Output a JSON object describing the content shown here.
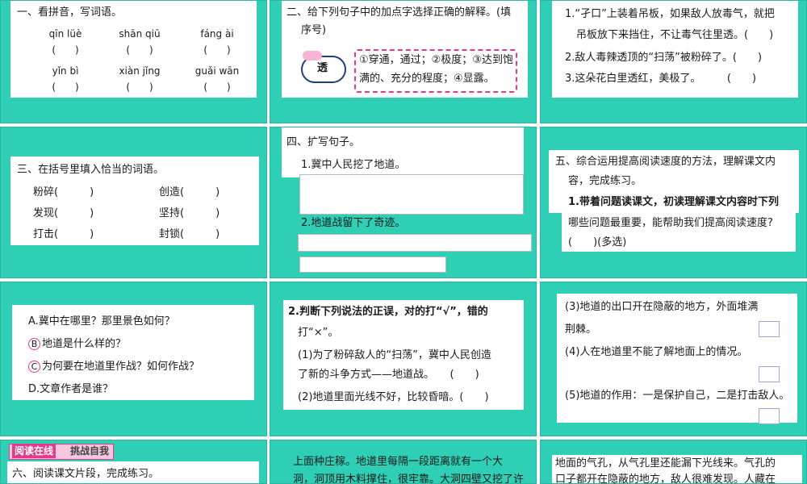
{
  "s1": {
    "title": "一、看拼音，写词语。",
    "row1": [
      "qīn lüè",
      "shān qiū",
      "fáng ài"
    ],
    "row2": [
      "yǐn bì",
      "xiàn jǐng",
      "guǎi wān"
    ],
    "paren": "(　　)"
  },
  "s2": {
    "title": "二、给下列句子中的加点字选择正确的解释。(填",
    "title2": "序号)",
    "word": "透",
    "opt1": "①穿通，通过；②极度；③达到饱",
    "opt2": "满的、充分的程度；④显露。"
  },
  "s3": {
    "l1a": "1.“孑口”上装着吊板，如果敌人放毒气，就把",
    "l1b": "吊板放下来挡住，不让毒气往里透。(　　)",
    "l2": "2.敌人毒辣透顶的“扫荡”被粉碎了。(　　)",
    "l3": "3.这朵花白里透红，美极了。　　　(　　)"
  },
  "s4": {
    "title": "三、在括号里填入恰当的词语。",
    "left": [
      "粉碎(　　　)",
      "发现(　　　)",
      "打击(　　　)"
    ],
    "right": [
      "创造(　　　)",
      "坚持(　　　)",
      "封锁(　　　)"
    ]
  },
  "s5": {
    "title": "四、扩写句子。",
    "l1": "1.冀中人民挖了地道。",
    "l2": "2.地道战留下了奇迹。"
  },
  "s6": {
    "l1": "五、综合运用提高阅读速度的方法，理解课文内",
    "l2": "容，完成练习。",
    "l3": "1.带着问题读课文，初读理解课文内容时下列",
    "l4": "哪些问题最重要，能帮助我们提高阅读速度?",
    "l5": "(　　)(多选)"
  },
  "s7": {
    "a": "A.冀中在哪里？那里景色如何？",
    "b": "地道是什么样的？",
    "c": "为何要在地道里作战？如何作战？",
    "d": "D.文章作者是谁？",
    "b_letter": "B",
    "c_letter": "C"
  },
  "s8": {
    "l1": "2.判断下列说法的正误，对的打“√”，错的",
    "l2": "打“×”。",
    "l3": "(1)为了粉碎敌人的“扫荡”，冀中人民创造",
    "l4": "了新的斗争方式——地道战。　　(　　)",
    "l5": "(2)地道里面光线不好，比较昏暗。(　　)"
  },
  "s9": {
    "l1": "(3)地道的出口开在隐蔽的地方，外面堆满",
    "l2": "荆棘。",
    "l3": "(4)人在地道里不能了解地面上的情况。",
    "l4": "(5)地道的作用：一是保护自己，二是打击敌人。",
    "paren": "(　)"
  },
  "s10": {
    "banner": "阅读在线",
    "banner2": "挑战自我",
    "l1": "六、阅读课文片段，完成练习。"
  },
  "s11": {
    "l1": "上面种庄稼。地道里每隔一段距离就有一个大",
    "l2": "洞，洞顶用木料撑住，很牢靠。大洞四壁又挖了许"
  },
  "s12": {
    "l1": "地面的气孔，从气孔里还能漏下光线来。气孔的",
    "l2": "口子都开在隐蔽的地方，敌人很难发现。人藏在"
  },
  "colors": {
    "teal": "#2fcfb5",
    "pink": "#e33b8a"
  }
}
